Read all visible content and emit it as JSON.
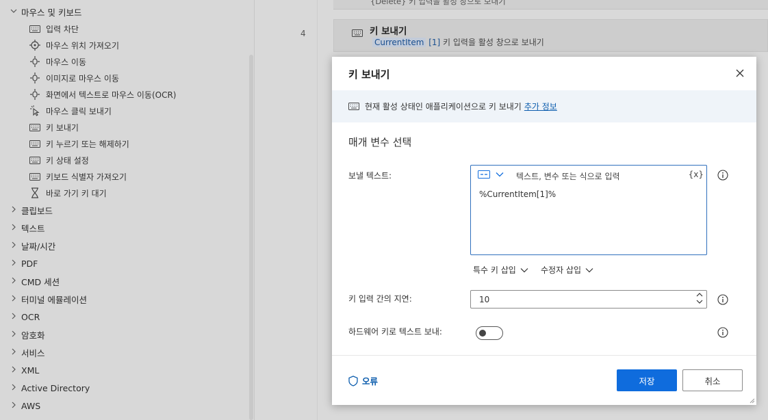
{
  "sidebar": {
    "top_group": "마우스 및 키보드",
    "items": [
      {
        "label": "입력 차단",
        "icon": "keyboard-icon"
      },
      {
        "label": "마우스 위치 가져오기",
        "icon": "crosshair-icon"
      },
      {
        "label": "마우스 이동",
        "icon": "mouse-move-icon"
      },
      {
        "label": "이미지로 마우스 이동",
        "icon": "mouse-move-icon"
      },
      {
        "label": "화면에서 텍스트로 마우스 이동(OCR)",
        "icon": "mouse-move-icon"
      },
      {
        "label": "마우스 클릭 보내기",
        "icon": "pointer-click-icon"
      },
      {
        "label": "키 보내기",
        "icon": "keyboard-icon"
      },
      {
        "label": "키 누르기 또는 해제하기",
        "icon": "keyboard-icon"
      },
      {
        "label": "키 상태 설정",
        "icon": "keyboard-icon"
      },
      {
        "label": "키보드 식별자 가져오기",
        "icon": "keyboard-icon"
      },
      {
        "label": "바로 가기 키 대기",
        "icon": "hourglass-icon"
      }
    ],
    "groups": [
      "클립보드",
      "텍스트",
      "날짜/시간",
      "PDF",
      "CMD 세션",
      "터미널 에뮬레이션",
      "OCR",
      "암호화",
      "서비스",
      "XML",
      "Active Directory",
      "AWS"
    ]
  },
  "flow": {
    "prev_step_sub": "{Delete} 키 입력을 활성 창으로 보내기",
    "step_number": "4",
    "step_title": "키 보내기",
    "step_token": "CurrentItem",
    "step_index": "[1]",
    "step_sub_rest": " 키 입력을 활성 창으로 보내기"
  },
  "dialog": {
    "title": "키 보내기",
    "banner_text": "현재 활성 상태인 애플리케이션으로 키 보내기",
    "banner_link": "추가 정보",
    "section_title": "매개 변수 선택",
    "text_label": "보낼 텍스트:",
    "text_placeholder": "텍스트, 변수 또는 식으로 입력",
    "text_var_button": "{x}",
    "text_value": "%CurrentItem[1]%",
    "special_key_label": "특수 키 삽입",
    "modifier_label": "수정자 삽입",
    "delay_label": "키 입력 간의 지연:",
    "delay_value": "10",
    "hardware_label": "하드웨어 키로 텍스트 보내:",
    "hardware_on": false,
    "error_label": "오류",
    "save_label": "저장",
    "cancel_label": "취소"
  },
  "colors": {
    "accent": "#0f6cdd",
    "link": "#0b5cad",
    "banner_bg": "#eff4f9"
  }
}
